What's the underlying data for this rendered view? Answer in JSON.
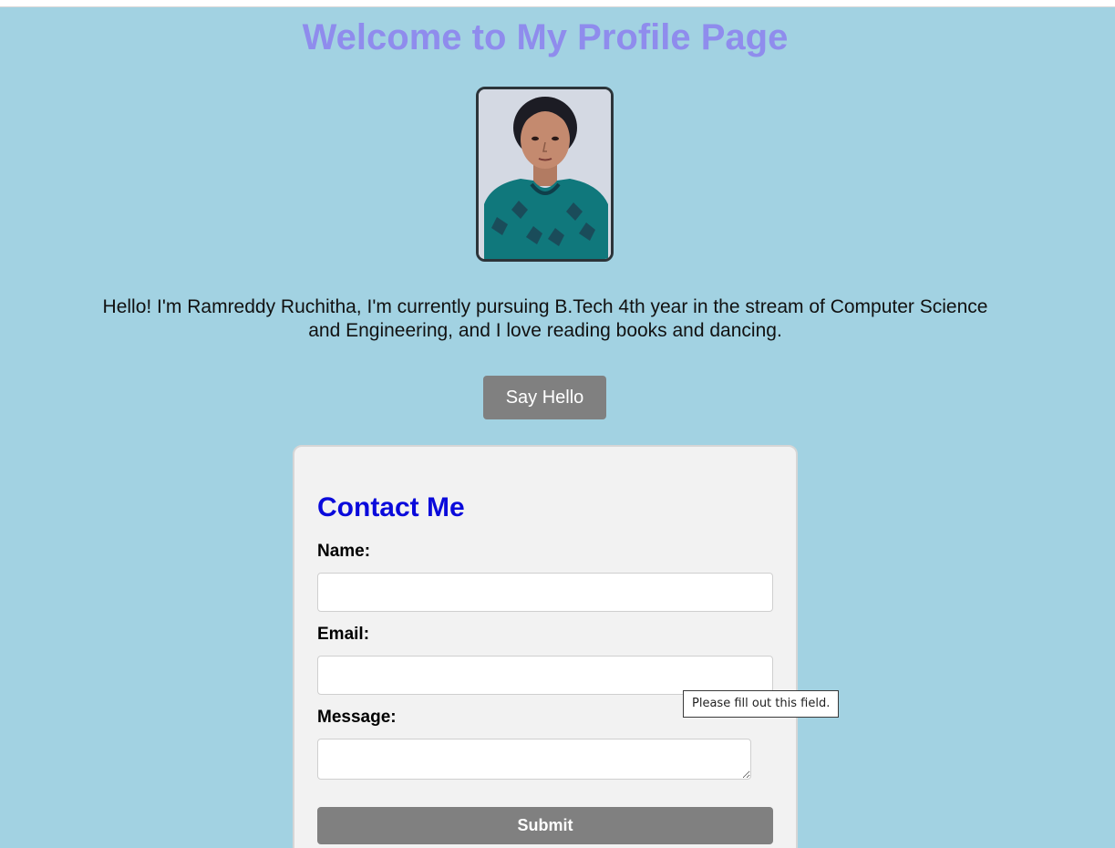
{
  "page": {
    "title": "Welcome to My Profile Page",
    "bio": "Hello! I'm Ramreddy Ruchitha, I'm currently pursuing B.Tech 4th year in the stream of Computer Science and Engineering, and I love reading books and dancing.",
    "say_hello_label": "Say Hello"
  },
  "contact": {
    "title": "Contact Me",
    "name_label": "Name:",
    "name_value": "",
    "email_label": "Email:",
    "email_value": "",
    "message_label": "Message:",
    "message_value": "",
    "submit_label": "Submit"
  },
  "validation": {
    "tooltip": "Please fill out this field."
  },
  "colors": {
    "background": "#a2d2e2",
    "title": "#8f8ced",
    "contact_title": "#0a0adb",
    "button": "#808080",
    "card": "#f2f2f2"
  }
}
